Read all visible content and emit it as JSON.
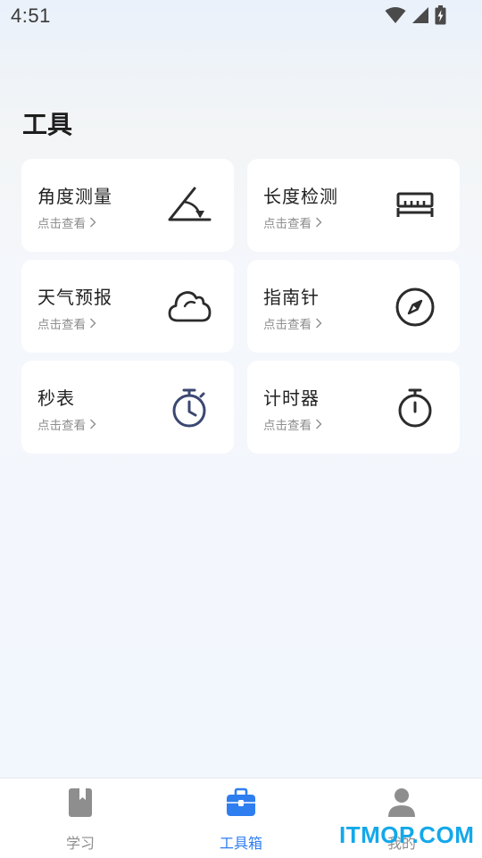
{
  "status_bar": {
    "time": "4:51",
    "icons": [
      "wifi-icon",
      "cellular-signal-icon",
      "battery-charging-icon"
    ]
  },
  "page": {
    "title": "工具"
  },
  "tools": [
    {
      "title": "角度测量",
      "subtitle": "点击查看",
      "icon": "protractor-angle-icon"
    },
    {
      "title": "长度检测",
      "subtitle": "点击查看",
      "icon": "ruler-icon"
    },
    {
      "title": "天气预报",
      "subtitle": "点击查看",
      "icon": "cloud-icon"
    },
    {
      "title": "指南针",
      "subtitle": "点击查看",
      "icon": "compass-icon"
    },
    {
      "title": "秒表",
      "subtitle": "点击查看",
      "icon": "stopwatch-icon"
    },
    {
      "title": "计时器",
      "subtitle": "点击查看",
      "icon": "timer-icon"
    }
  ],
  "tab_bar": {
    "tabs": [
      {
        "label": "学习",
        "icon": "book-icon",
        "active": false
      },
      {
        "label": "工具箱",
        "icon": "toolbox-icon",
        "active": true
      },
      {
        "label": "我的",
        "icon": "user-icon",
        "active": false
      }
    ]
  },
  "watermark": {
    "text": "ITMOP.COM"
  },
  "colors": {
    "accent": "#2f7ef0",
    "inactive_tab": "#8e8e8e",
    "watermark": "#13a8ea",
    "stopwatch": "#3b4772",
    "icon_dark": "#2b2b2b"
  }
}
